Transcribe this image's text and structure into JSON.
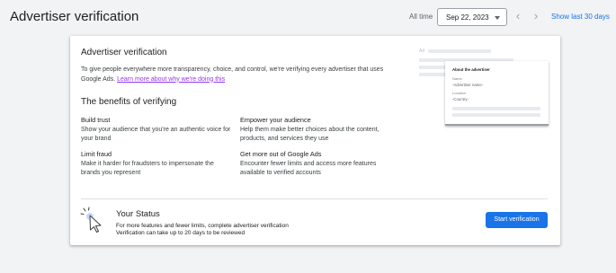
{
  "header": {
    "title": "Advertiser verification",
    "range_label": "All time",
    "date_value": "Sep 22, 2023",
    "prev_arrow": "‹",
    "next_arrow": "›",
    "show_last_label": "Show last 30 days"
  },
  "card": {
    "title": "Advertiser verification",
    "intro_text": "To give people everywhere more transparency, choice, and control, we're verifying every advertiser that uses Google Ads. ",
    "intro_link": "Learn more about why we're doing this",
    "benefits_heading": "The benefits of verifying",
    "benefits": [
      {
        "title": "Build trust",
        "text": "Show your audience that you're an authentic voice for your brand"
      },
      {
        "title": "Empower your audience",
        "text": "Help them make better choices about the content, products, and services they use"
      },
      {
        "title": "Limit fraud",
        "text": "Make it harder for fraudsters to impersonate the brands you represent"
      },
      {
        "title": "Get more out of Google Ads",
        "text": "Encounter fewer limits and access more features available to verified accounts"
      }
    ],
    "illustration": {
      "ad_tag": "Ad",
      "about_title": "About the advertiser",
      "name_label": "Name",
      "name_value": "-Advertiser name-",
      "location_label": "Location",
      "location_value": "-Country-"
    }
  },
  "status": {
    "title": "Your Status",
    "line1": "For more features and fewer limits, complete advertiser verification",
    "line2": "Verification can take up to 20 days to be reviewed",
    "button_label": "Start verification"
  },
  "colors": {
    "accent": "#1a73e8",
    "link_visited": "#9334e6",
    "background": "#f1f3f4"
  }
}
